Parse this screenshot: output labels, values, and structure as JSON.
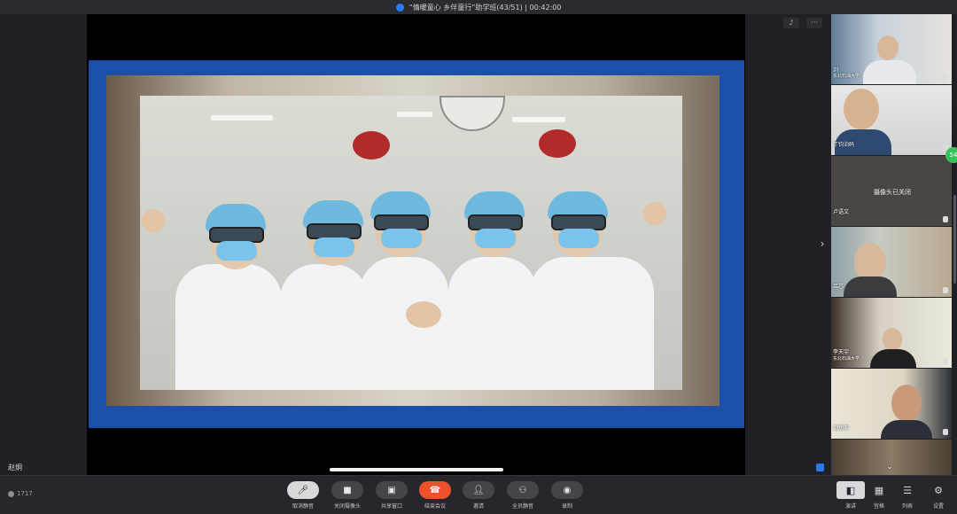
{
  "window": {
    "title": "“情暖童心 乡伴童行”助学班(43/51)  |  00:42:00"
  },
  "stage": {
    "presenter_name": "赵炯"
  },
  "gallery": {
    "badge_count": "54",
    "camera_off_text": "摄像头已关闭",
    "participants": [
      {
        "name": "刘",
        "sub": "东北石油大学"
      },
      {
        "name": "丁钧泊码",
        "sub": ""
      },
      {
        "name": "卢语文",
        "sub": ""
      },
      {
        "name": "吕芯",
        "sub": ""
      },
      {
        "name": "李天宇",
        "sub": "东北石油大学"
      },
      {
        "name": "刘润坤",
        "sub": ""
      },
      {
        "name": "",
        "sub": ""
      }
    ]
  },
  "toolbar": {
    "signal_text": "1717",
    "buttons": [
      {
        "label": "取消静音",
        "icon": "mic-off-icon"
      },
      {
        "label": "关闭摄像头",
        "icon": "camera-icon"
      },
      {
        "label": "共享窗口",
        "icon": "share-screen-icon"
      },
      {
        "label": "结束会议",
        "icon": "hang-up-icon"
      },
      {
        "label": "邀请",
        "icon": "invite-icon"
      },
      {
        "label": "全员静音",
        "icon": "mute-all-icon"
      },
      {
        "label": "录制",
        "icon": "record-icon"
      }
    ],
    "views": [
      {
        "label": "演讲",
        "icon": "speaker-view-icon"
      },
      {
        "label": "宫格",
        "icon": "grid-view-icon"
      },
      {
        "label": "列表",
        "icon": "list-view-icon"
      },
      {
        "label": "设置",
        "icon": "settings-icon"
      }
    ]
  }
}
